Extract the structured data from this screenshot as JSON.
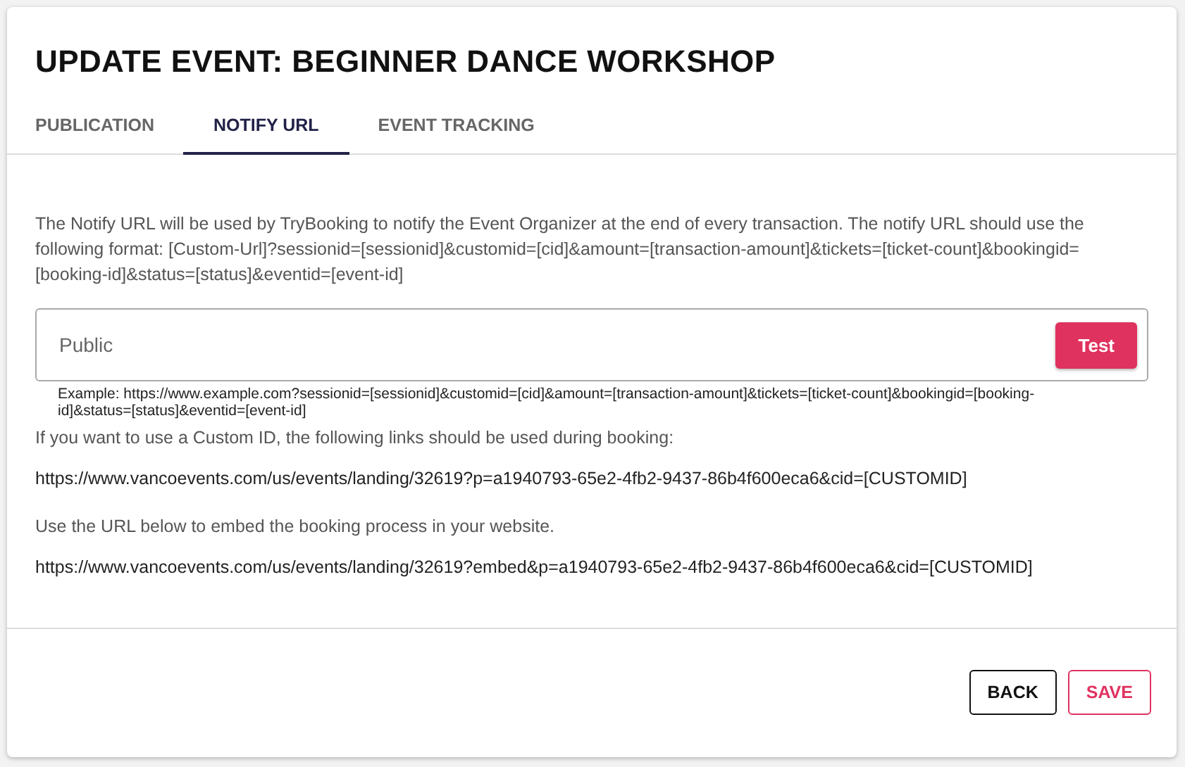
{
  "title": "UPDATE EVENT: BEGINNER DANCE WORKSHOP",
  "tabs": [
    {
      "label": "PUBLICATION",
      "selected": false
    },
    {
      "label": "NOTIFY URL",
      "selected": true
    },
    {
      "label": "EVENT TRACKING",
      "selected": false
    }
  ],
  "description": "The Notify URL will be used by TryBooking to notify the Event Organizer at the end of every transaction. The notify URL should use the following format: [Custom-Url]?sessionid=[sessionid]&customid=[cid]&amount=[transaction-amount]&tickets=[ticket-count]&bookingid=[booking-id]&status=[status]&eventid=[event-id]",
  "notify_field": {
    "placeholder": "Public",
    "button": "Test"
  },
  "example": "Example: https://www.example.com?sessionid=[sessionid]&customid=[cid]&amount=[transaction-amount]&tickets=[ticket-count]&bookingid=[booking-id]&status=[status]&eventid=[event-id]",
  "custom_id_note": "If you want to use a Custom ID, the following links should be used during booking:",
  "custom_id_url": "https://www.vancoevents.com/us/events/landing/32619?p=a1940793-65e2-4fb2-9437-86b4f600eca6&cid=[CUSTOMID]",
  "embed_note": "Use the URL below to embed the booking process in your website.",
  "embed_url": "https://www.vancoevents.com/us/events/landing/32619?embed&p=a1940793-65e2-4fb2-9437-86b4f600eca6&cid=[CUSTOMID]",
  "buttons": [
    {
      "label": "BACK",
      "kind": "secondary"
    },
    {
      "label": "SAVE",
      "kind": "primary"
    }
  ]
}
